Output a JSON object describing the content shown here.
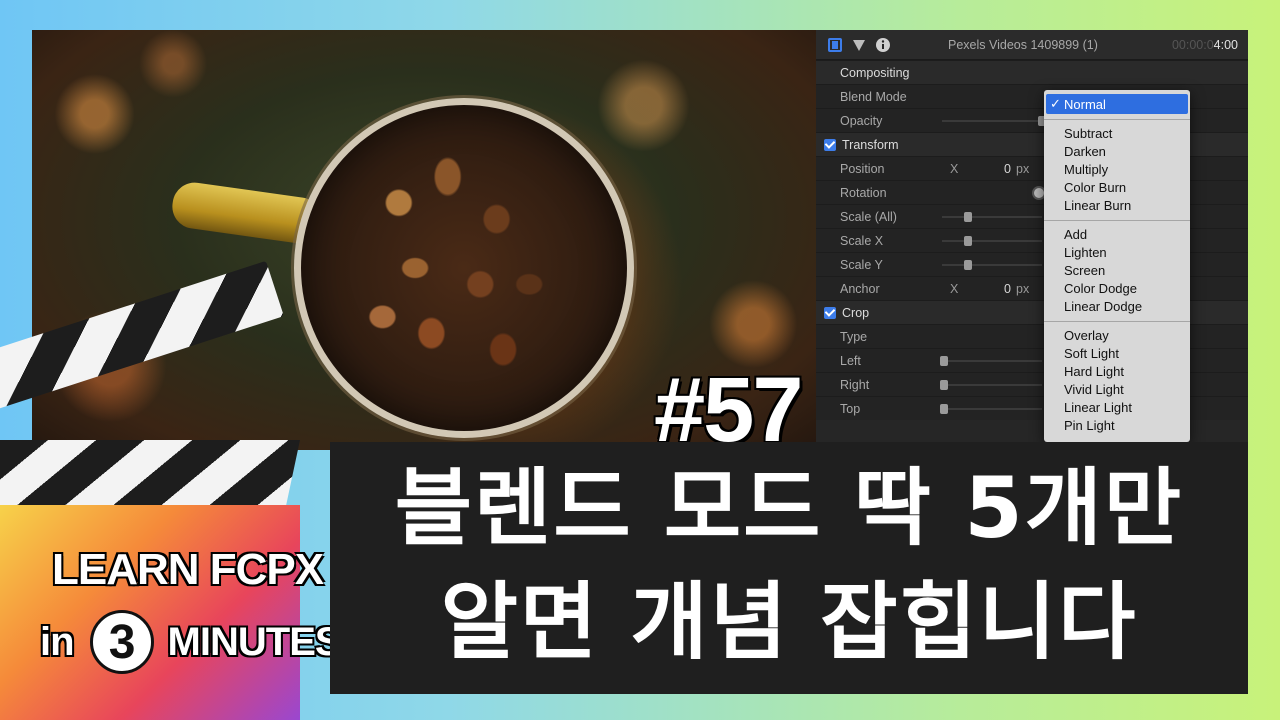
{
  "thumbnail": {
    "episode": "#57",
    "title_line1": "블렌드 모드 딱 5개만",
    "title_line2": "알면 개념 잡힙니다"
  },
  "branding": {
    "learn": "LEARN FCPX",
    "in": "in",
    "number": "3",
    "minutes": "MINUTES"
  },
  "inspector": {
    "header": {
      "icons": [
        "film-icon",
        "filter-icon",
        "info-icon"
      ],
      "clip_name": "Pexels Videos 1409899 (1)",
      "timecode_dim": "00:00:0",
      "timecode_bright": "4:00"
    },
    "compositing": {
      "label": "Compositing",
      "blend_mode_label": "Blend Mode",
      "opacity_label": "Opacity"
    },
    "transform": {
      "label": "Transform",
      "position": {
        "label": "Position",
        "axis": "X",
        "value": "0",
        "unit": "px"
      },
      "rotation_label": "Rotation",
      "scale_all_label": "Scale (All)",
      "scale_x_label": "Scale X",
      "scale_y_label": "Scale Y",
      "anchor": {
        "label": "Anchor",
        "axis": "X",
        "value": "0",
        "unit": "px"
      }
    },
    "crop": {
      "label": "Crop",
      "type_label": "Type",
      "left_label": "Left",
      "right_label": "Right",
      "top_label": "Top"
    },
    "blend_menu": {
      "selected": "Normal",
      "groups": [
        [
          "Subtract",
          "Darken",
          "Multiply",
          "Color Burn",
          "Linear Burn"
        ],
        [
          "Add",
          "Lighten",
          "Screen",
          "Color Dodge",
          "Linear Dodge"
        ],
        [
          "Overlay",
          "Soft Light",
          "Hard Light",
          "Vivid Light",
          "Linear Light",
          "Pin Light"
        ]
      ]
    }
  },
  "colors": {
    "accent_blue": "#2e6ee0",
    "checkbox_blue": "#3d7dea",
    "panel_bg": "#262626",
    "title_box_bg": "#1f1f1f"
  }
}
